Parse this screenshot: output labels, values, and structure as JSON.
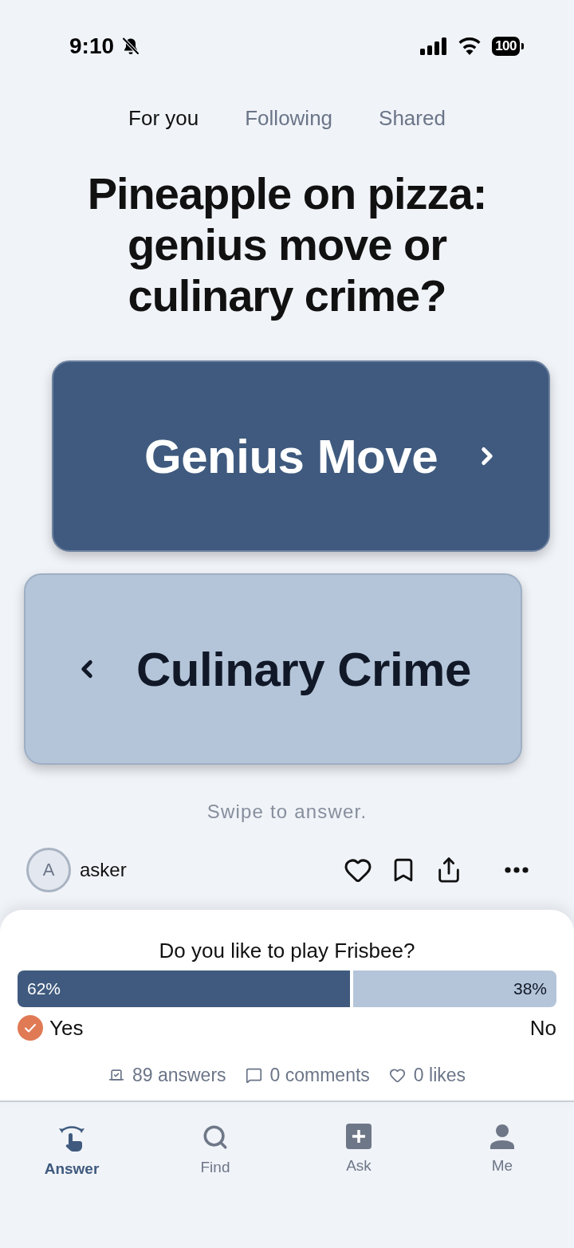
{
  "status_bar": {
    "time": "9:10",
    "silent": true,
    "battery": "100"
  },
  "tabs": [
    {
      "label": "For you",
      "selected": true
    },
    {
      "label": "Following",
      "selected": false
    },
    {
      "label": "Shared",
      "selected": false
    }
  ],
  "question": {
    "title": "Pineapple on pizza: genius move or culinary crime?"
  },
  "answers": [
    {
      "label": "Genius Move",
      "kind": "right"
    },
    {
      "label": "Culinary Crime",
      "kind": "left"
    }
  ],
  "hint": "Swipe to answer.",
  "author": {
    "initial": "A",
    "name": "asker"
  },
  "poll": {
    "question": "Do you like to play Frisbee?",
    "options": [
      {
        "label": "Yes",
        "percent": "62%",
        "level": 0.62,
        "selected": true
      },
      {
        "label": "No",
        "percent": "38%",
        "level": 0.38,
        "selected": false
      }
    ],
    "stats": [
      {
        "kind": "answers",
        "text": "89 answers"
      },
      {
        "kind": "comments",
        "text": "0 comments"
      },
      {
        "kind": "likes",
        "text": "0 likes"
      }
    ]
  },
  "nav": [
    {
      "kind": "answer",
      "label": "Answer",
      "selected": true
    },
    {
      "kind": "find",
      "label": "Find",
      "selected": false
    },
    {
      "kind": "ask",
      "label": "Ask",
      "selected": false
    },
    {
      "kind": "me",
      "label": "Me",
      "selected": false
    }
  ]
}
